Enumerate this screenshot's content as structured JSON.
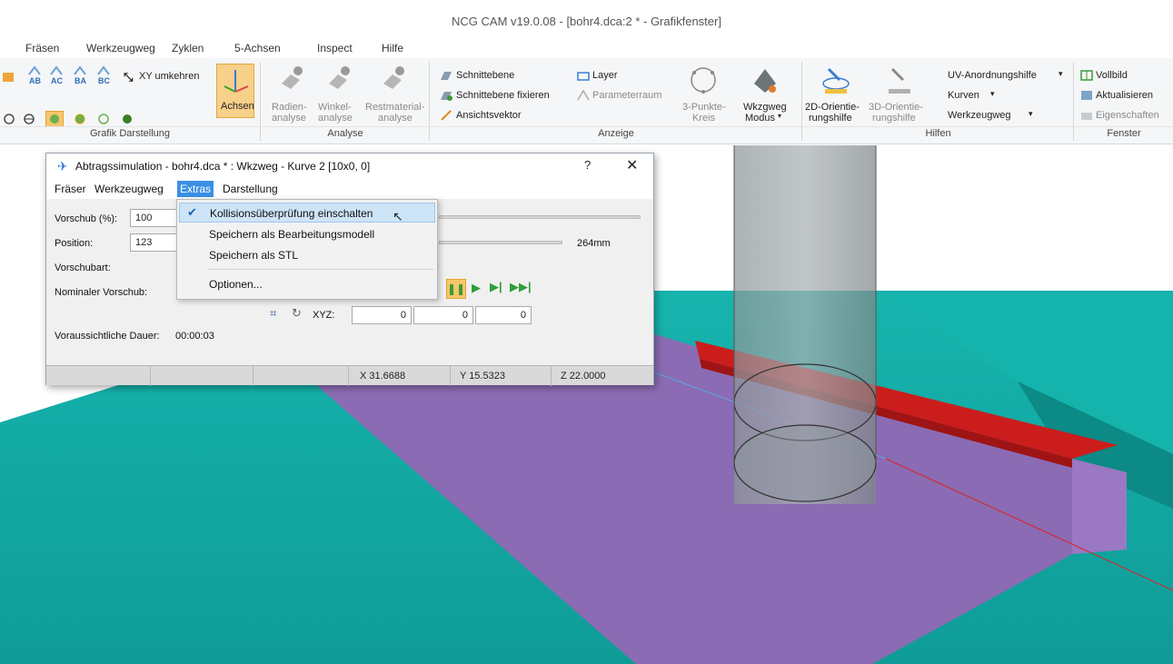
{
  "window": {
    "title": "NCG CAM v19.0.08 - [bohr4.dca:2 * - Grafikfenster]"
  },
  "menubar": {
    "items": [
      "Fräsen",
      "Werkzeugweg",
      "Zyklen",
      "5-Achsen",
      "Inspect",
      "Hilfe"
    ]
  },
  "ribbon": {
    "grafik": {
      "label": "Grafik Darstellung",
      "view_buttons": [
        "AB",
        "AC",
        "BA",
        "BC"
      ],
      "xy_umkehren": "XY umkehren",
      "achsen": "Achsen"
    },
    "analyse": {
      "label": "Analyse",
      "radien_1": "Radien-",
      "radien_2": "analyse",
      "winkel_1": "Winkel-",
      "winkel_2": "analyse",
      "rest_1": "Restmaterial-",
      "rest_2": "analyse"
    },
    "anzeige": {
      "label": "Anzeige",
      "schnittebene": "Schnittebene",
      "schnittebene_fixieren": "Schnittebene fixieren",
      "ansichtsvektor": "Ansichtsvektor",
      "layer": "Layer",
      "parameterraum": "Parameterraum",
      "kreis_1": "3-Punkte-",
      "kreis_2": "Kreis",
      "wkz_1": "Wkzgweg",
      "wkz_2": "Modus"
    },
    "hilfen": {
      "label": "Hilfen",
      "orient2d_1": "2D-Orientie-",
      "orient2d_2": "rungshilfe",
      "orient3d_1": "3D-Orientie-",
      "orient3d_2": "rungshilfe",
      "uv": "UV-Anordnungshilfe",
      "kurven": "Kurven",
      "werkzeugweg": "Werkzeugweg"
    },
    "fenster": {
      "label": "Fenster",
      "vollbild": "Vollbild",
      "aktualisieren": "Aktualisieren",
      "eigenschaften": "Eigenschaften"
    }
  },
  "dialog": {
    "title": "Abtragssimulation - bohr4.dca * : Wkzweg - Kurve 2 [10x0, 0]",
    "help": "?",
    "close": "✕",
    "menu": [
      "Fräser",
      "Werkzeugweg",
      "Extras",
      "Darstellung"
    ],
    "active_menu": "Extras",
    "vorschub_label": "Vorschub (%):",
    "vorschub_value": "100",
    "position_label": "Position:",
    "position_value": "123",
    "position_length": "264mm",
    "vorschubart_label": "Vorschubart:",
    "nominaler_label": "Nominaler Vorschub:",
    "xyz_label": "XYZ:",
    "xyz": [
      "0",
      "0",
      "0"
    ],
    "dauer_label": "Voraussichtliche Dauer:",
    "dauer_value": "00:00:03",
    "status": {
      "x": "X 31.6688",
      "y": "Y 15.5323",
      "z": "Z 22.0000"
    }
  },
  "dropdown": {
    "items": [
      {
        "label": "Kollisionsüberprüfung einschalten",
        "checked": true,
        "highlighted": true
      },
      {
        "label": "Speichern als Bearbeitungsmodell",
        "checked": false
      },
      {
        "label": "Speichern als STL",
        "checked": false
      },
      {
        "label": "Optionen...",
        "checked": false
      }
    ]
  },
  "colors": {
    "teal": "#14aaa4",
    "purple": "#8b6bb3",
    "red": "#cc1d1d",
    "accent": "#3b8fe3",
    "gray": "#9aa1a3"
  }
}
